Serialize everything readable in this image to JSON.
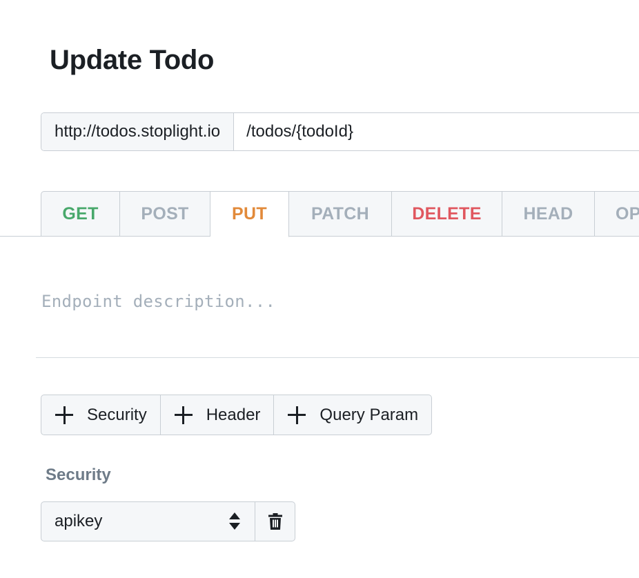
{
  "page": {
    "title": "Update Todo"
  },
  "url": {
    "host": "http://todos.stoplight.io",
    "path": "/todos/{todoId}"
  },
  "methods": {
    "active": "PUT",
    "tabs": [
      {
        "label": "GET",
        "color": "#48a86b"
      },
      {
        "label": "POST",
        "color": "#a4afba"
      },
      {
        "label": "PUT",
        "color": "#e28a3a"
      },
      {
        "label": "PATCH",
        "color": "#a4afba"
      },
      {
        "label": "DELETE",
        "color": "#e0575f"
      },
      {
        "label": "HEAD",
        "color": "#a4afba"
      },
      {
        "label": "OP",
        "color": "#a4afba"
      }
    ]
  },
  "description": {
    "placeholder": "Endpoint description..."
  },
  "add_buttons": {
    "security": "Security",
    "header": "Header",
    "query_param": "Query Param"
  },
  "security": {
    "section_label": "Security",
    "selected": "apikey"
  },
  "icons": {
    "add": "plus-icon",
    "select": "updown-icon",
    "delete": "trash-icon"
  }
}
